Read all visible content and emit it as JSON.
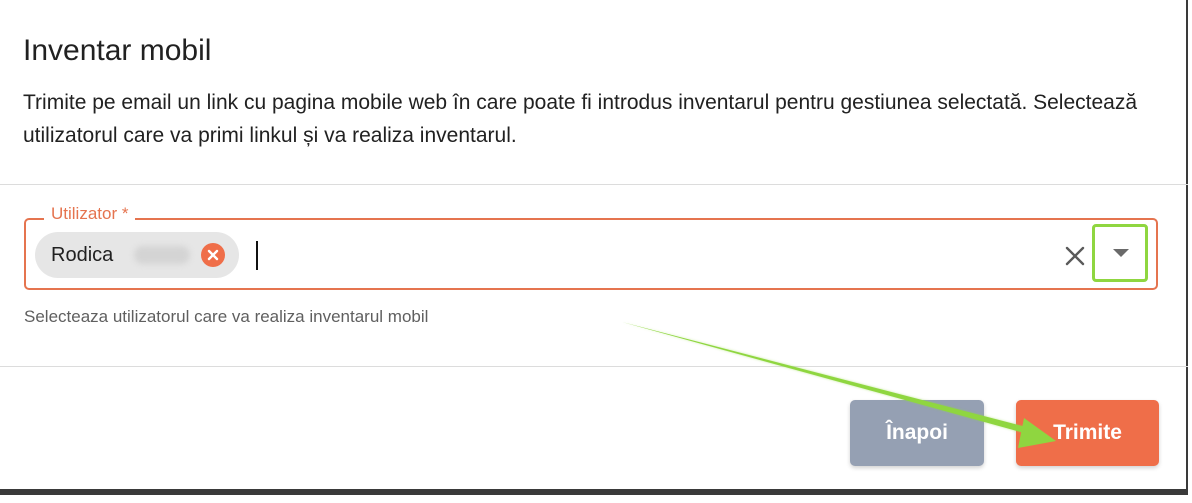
{
  "dialog": {
    "title": "Inventar mobil",
    "description": "Trimite pe email un link cu pagina mobile web în care poate fi introdus inventarul pentru gestiunea selectată. Selectează utilizatorul care va primi linkul și va realiza inventarul."
  },
  "user_field": {
    "label": "Utilizator *",
    "selected_chip": "Rodica",
    "value": "",
    "helper_text": "Selecteaza utilizatorul care va realiza inventarul mobil"
  },
  "actions": {
    "back_label": "Înapoi",
    "send_label": "Trimite"
  },
  "icons": {
    "chip_remove": "close-circle-icon",
    "clear": "close-icon",
    "dropdown": "caret-down-icon"
  },
  "colors": {
    "accent": "#ef6e49",
    "secondary_button": "#95a0b3",
    "annotation_green": "#8fd640"
  }
}
